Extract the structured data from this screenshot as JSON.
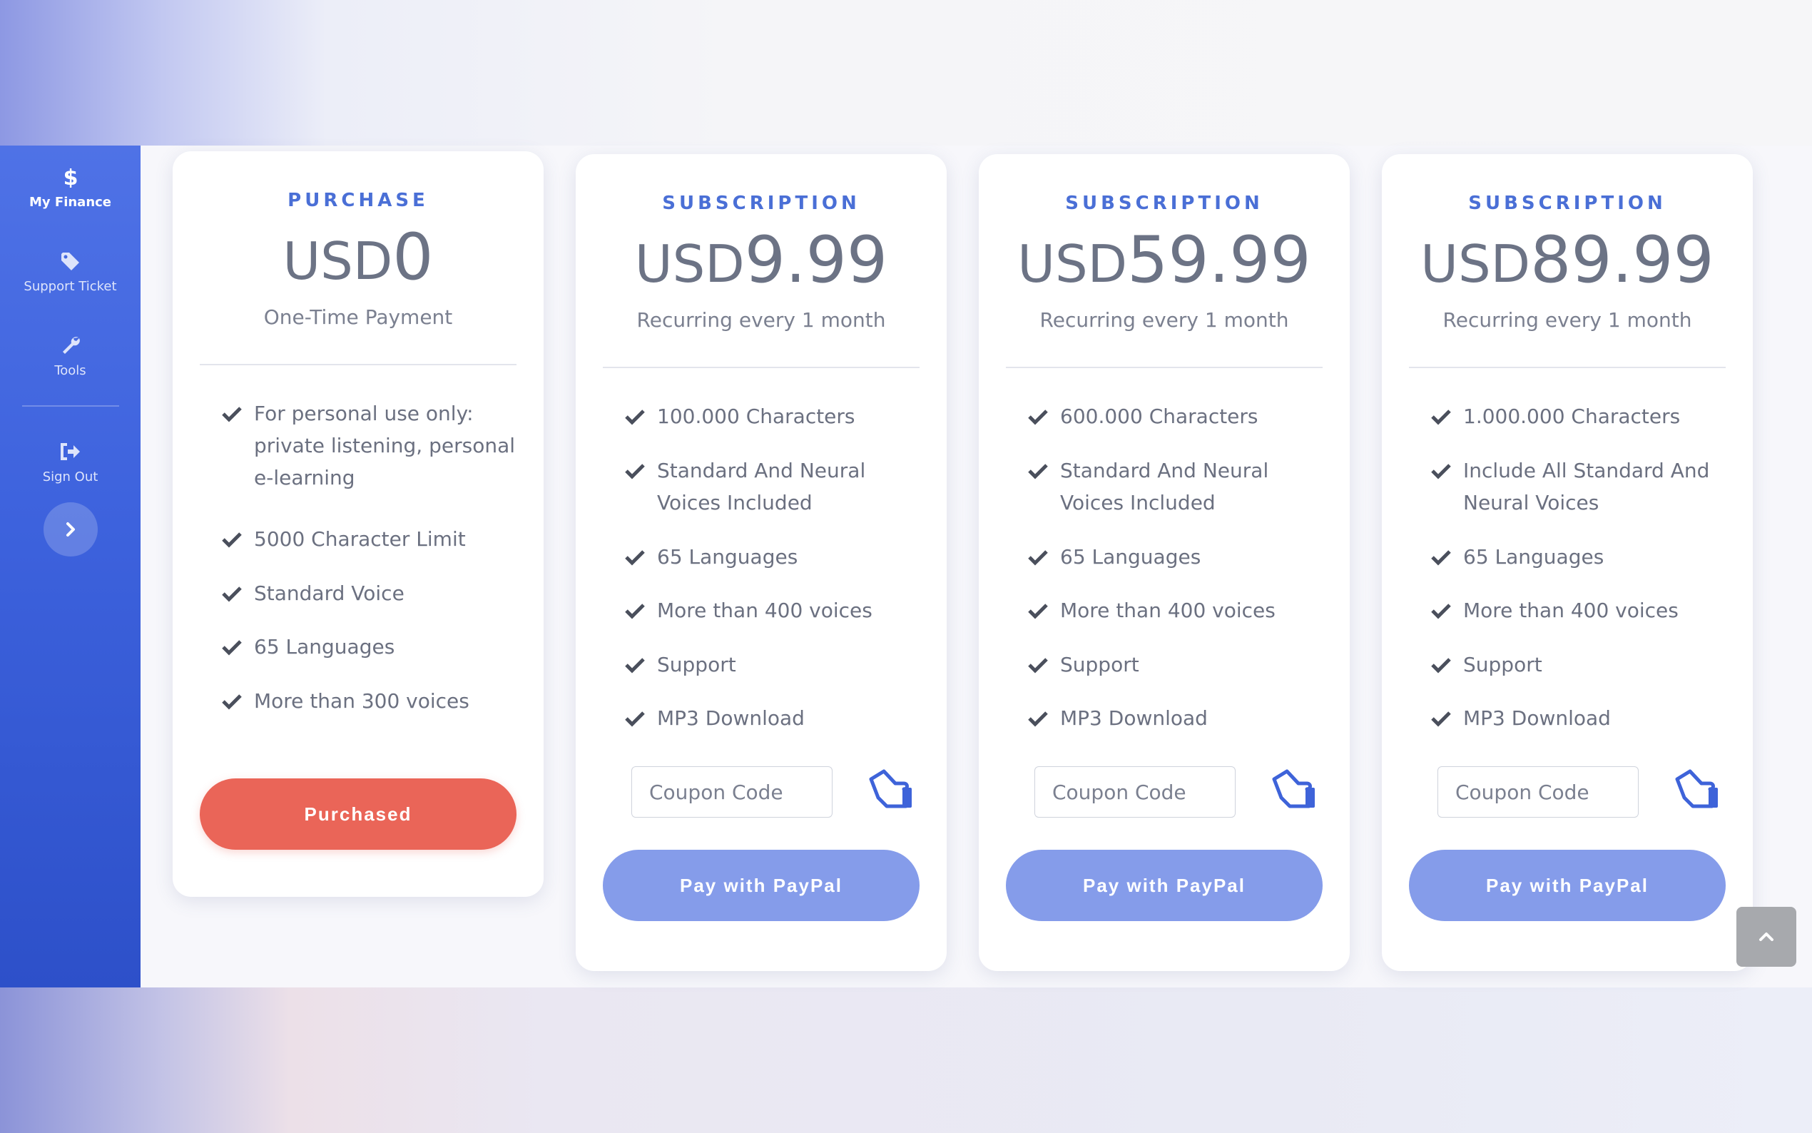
{
  "sidebar": {
    "items": [
      {
        "label": "My Finance",
        "icon": "dollar-icon",
        "active": true
      },
      {
        "label": "Support Ticket",
        "icon": "tag-icon"
      },
      {
        "label": "Tools",
        "icon": "wrench-icon"
      },
      {
        "label": "Sign Out",
        "icon": "sign-out-icon"
      }
    ],
    "toggle_icon": "chevron-right-icon"
  },
  "plans": [
    {
      "type": "PURCHASE",
      "currency": "USD",
      "amount": "0",
      "period": "One-Time Payment",
      "features": [
        "For personal use only: private listening, personal e-learning",
        "5000 Character Limit",
        "Standard Voice",
        "65 Languages",
        "More than 300 voices"
      ],
      "button": "Purchased"
    },
    {
      "type": "SUBSCRIPTION",
      "currency": "USD",
      "amount": "9.99",
      "period": "Recurring every 1 month",
      "features": [
        "100.000 Characters",
        "Standard And Neural Voices Included",
        "65 Languages",
        "More than 400 voices",
        "Support",
        "MP3 Download"
      ],
      "coupon_placeholder": "Coupon Code",
      "button": "Pay with PayPal"
    },
    {
      "type": "SUBSCRIPTION",
      "currency": "USD",
      "amount": "59.99",
      "period": "Recurring every 1 month",
      "features": [
        "600.000 Characters",
        "Standard And Neural Voices Included",
        "65 Languages",
        "More than 400 voices",
        "Support",
        "MP3 Download"
      ],
      "coupon_placeholder": "Coupon Code",
      "button": "Pay with PayPal"
    },
    {
      "type": "SUBSCRIPTION",
      "currency": "USD",
      "amount": "89.99",
      "period": "Recurring every 1 month",
      "features": [
        "1.000.000 Characters",
        "Include All Standard And Neural Voices",
        "65 Languages",
        "More than 400 voices",
        "Support",
        "MP3 Download"
      ],
      "coupon_placeholder": "Coupon Code",
      "button": "Pay with PayPal"
    }
  ],
  "colors": {
    "accent": "#4a6fd6",
    "sidebar": "#3d62dd",
    "purchased": "#ea6558",
    "paypal": "#859cea"
  }
}
